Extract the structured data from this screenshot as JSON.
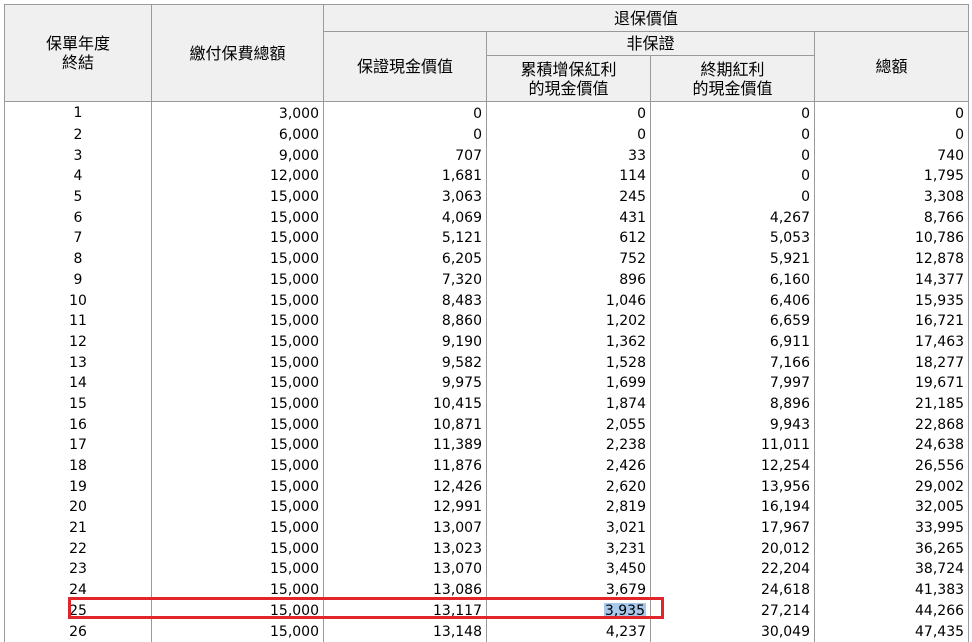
{
  "header": {
    "year": "保單年度\n終結",
    "total_paid": "繳付保費總額",
    "surrender_value": "退保價值",
    "guaranteed": "保證現金價值",
    "non_guaranteed": "非保證",
    "reversionary_bonus": "累積增保紅利\n的現金價值",
    "terminal_bonus": "終期紅利\n的現金價值",
    "total": "總額"
  },
  "rows": [
    [
      "1",
      "3,000",
      "0",
      "0",
      "0",
      "0"
    ],
    [
      "2",
      "6,000",
      "0",
      "0",
      "0",
      "0"
    ],
    [
      "3",
      "9,000",
      "707",
      "33",
      "0",
      "740"
    ],
    [
      "4",
      "12,000",
      "1,681",
      "114",
      "0",
      "1,795"
    ],
    [
      "5",
      "15,000",
      "3,063",
      "245",
      "0",
      "3,308"
    ],
    [
      "6",
      "15,000",
      "4,069",
      "431",
      "4,267",
      "8,766"
    ],
    [
      "7",
      "15,000",
      "5,121",
      "612",
      "5,053",
      "10,786"
    ],
    [
      "8",
      "15,000",
      "6,205",
      "752",
      "5,921",
      "12,878"
    ],
    [
      "9",
      "15,000",
      "7,320",
      "896",
      "6,160",
      "14,377"
    ],
    [
      "10",
      "15,000",
      "8,483",
      "1,046",
      "6,406",
      "15,935"
    ],
    [
      "11",
      "15,000",
      "8,860",
      "1,202",
      "6,659",
      "16,721"
    ],
    [
      "12",
      "15,000",
      "9,190",
      "1,362",
      "6,911",
      "17,463"
    ],
    [
      "13",
      "15,000",
      "9,582",
      "1,528",
      "7,166",
      "18,277"
    ],
    [
      "14",
      "15,000",
      "9,975",
      "1,699",
      "7,997",
      "19,671"
    ],
    [
      "15",
      "15,000",
      "10,415",
      "1,874",
      "8,896",
      "21,185"
    ],
    [
      "16",
      "15,000",
      "10,871",
      "2,055",
      "9,943",
      "22,868"
    ],
    [
      "17",
      "15,000",
      "11,389",
      "2,238",
      "11,011",
      "24,638"
    ],
    [
      "18",
      "15,000",
      "11,876",
      "2,426",
      "12,254",
      "26,556"
    ],
    [
      "19",
      "15,000",
      "12,426",
      "2,620",
      "13,956",
      "29,002"
    ],
    [
      "20",
      "15,000",
      "12,991",
      "2,819",
      "16,194",
      "32,005"
    ],
    [
      "21",
      "15,000",
      "13,007",
      "3,021",
      "17,967",
      "33,995"
    ],
    [
      "22",
      "15,000",
      "13,023",
      "3,231",
      "20,012",
      "36,265"
    ],
    [
      "23",
      "15,000",
      "13,070",
      "3,450",
      "22,204",
      "38,724"
    ],
    [
      "24",
      "15,000",
      "13,086",
      "3,679",
      "24,618",
      "41,383"
    ],
    [
      "25",
      "15,000",
      "13,117",
      "3,935",
      "27,214",
      "44,266"
    ],
    [
      "26",
      "15,000",
      "13,148",
      "4,237",
      "30,049",
      "47,435"
    ]
  ],
  "highlight": {
    "row_year": "25",
    "selected_cell": "3,935",
    "box_color": "#e0262b",
    "selection_color": "#a9c9ec"
  }
}
